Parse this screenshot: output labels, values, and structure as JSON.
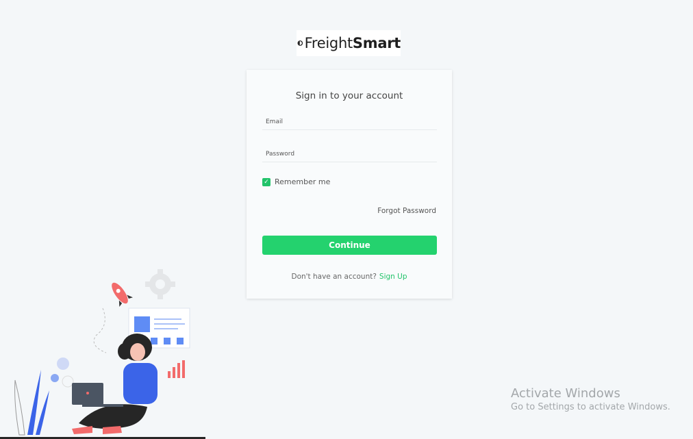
{
  "brand": {
    "name_regular": "Freight",
    "name_bold": "Smart"
  },
  "login": {
    "title": "Sign in to your account",
    "email_placeholder": "Email",
    "password_placeholder": "Password",
    "remember_label": "Remember me",
    "remember_checked": true,
    "forgot_label": "Forgot Password",
    "continue_label": "Continue",
    "signup_prompt": "Don't have an account?",
    "signup_link": "Sign Up"
  },
  "watermark": {
    "title": "Activate Windows",
    "subtitle": "Go to Settings to activate Windows."
  },
  "icons": {
    "logo": "freightsmart-logo-icon",
    "checkbox": "checkmark-icon",
    "illustration": "woman-laptop-illustration"
  },
  "colors": {
    "accent": "#24d26e",
    "link": "#22c36a",
    "background": "#f4f7f9",
    "card": "#f9fbfc"
  }
}
